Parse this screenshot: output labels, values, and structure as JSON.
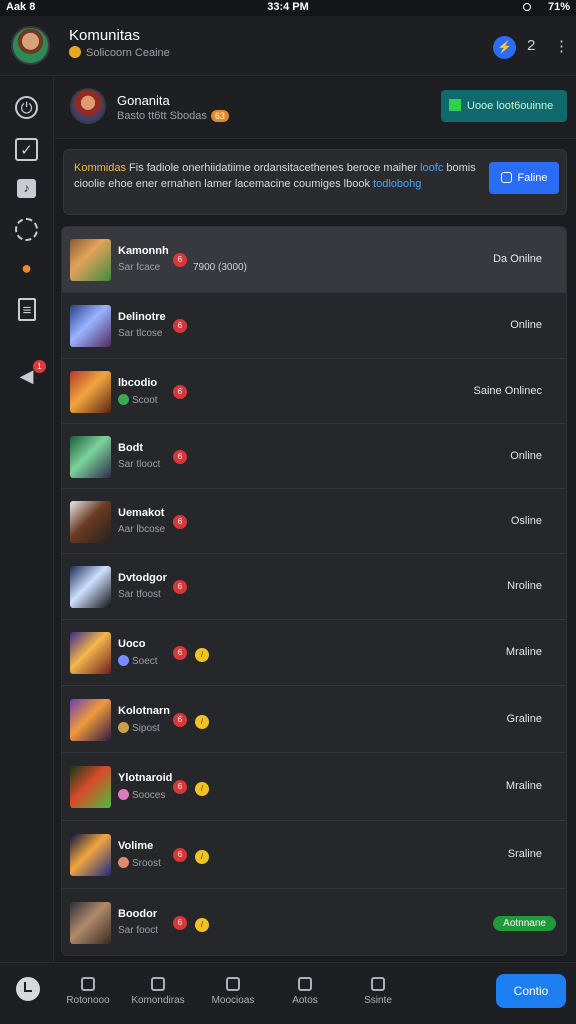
{
  "status": {
    "left": "Aak 8",
    "time": "33:4 PM",
    "battery": "71%"
  },
  "header": {
    "title": "Komunitas",
    "subtitle": "Solicoorn Ceaine",
    "notif_count": "2",
    "more": "⋮"
  },
  "community": {
    "name": "Gonanita",
    "meta": "Basto tt6tt Sbodas",
    "pill": "63",
    "join_label": "Uooe loot6ouinne"
  },
  "notice": {
    "highlight": "Kommidas",
    "text": "Fis fadiole onerhiidatiime ordansitacethenes beroce maiher",
    "line2": "bomis cioolie ehoe ener ernahen lamer lacemacine coumiges",
    "link1": "loofc",
    "trail": "lbook",
    "link2": "todlobohg",
    "edit_label": "Faline"
  },
  "members": [
    {
      "name": "Kamonnh",
      "sub": "Sar fcace",
      "extra": "7900 (3000)",
      "status": "Da Onilne",
      "badge": "6",
      "badge2": ""
    },
    {
      "name": "Delinotre",
      "sub": "Sar tlcose",
      "extra": "",
      "status": "Online",
      "badge": "6",
      "badge2": ""
    },
    {
      "name": "lbcodio",
      "sub": "Scoot",
      "extra": "",
      "status": "Saine Onlinec",
      "badge": "6",
      "badge2": ""
    },
    {
      "name": "Bodt",
      "sub": "Sar tlooct",
      "extra": "",
      "status": "Online",
      "badge": "6",
      "badge2": ""
    },
    {
      "name": "Uemakot",
      "sub": "Aar lbcose",
      "extra": "",
      "status": "Osline",
      "badge": "6",
      "badge2": ""
    },
    {
      "name": "Dvtodgor",
      "sub": "Sar tfoost",
      "extra": "",
      "status": "Nroline",
      "badge": "6",
      "badge2": ""
    },
    {
      "name": "Uoco",
      "sub": "Soect",
      "extra": "",
      "status": "Mraline",
      "badge": "6",
      "badge2": "/"
    },
    {
      "name": "Kolotnarn",
      "sub": "Sipost",
      "extra": "",
      "status": "Graline",
      "badge": "6",
      "badge2": "/"
    },
    {
      "name": "Ylotnaroid",
      "sub": "Sooces",
      "extra": "",
      "status": "Mraline",
      "badge": "6",
      "badge2": "/"
    },
    {
      "name": "Volime",
      "sub": "Sroost",
      "extra": "",
      "status": "Sraline",
      "badge": "6",
      "badge2": "/"
    },
    {
      "name": "Boodor",
      "sub": "Sar fooct",
      "extra": "",
      "status": "Aotnnane",
      "badge": "6",
      "badge2": "/"
    }
  ],
  "nav": {
    "item1": "Rotonooo",
    "item2": "Komondiras",
    "item3": "Moocioas",
    "item4": "Aotos",
    "item5": "Ssinte",
    "cta": "Contio"
  },
  "colors": {
    "accent": "#2a6df4",
    "join": "#10696d",
    "online_pill": "#1f9a3a",
    "badge": "#d8373a"
  }
}
